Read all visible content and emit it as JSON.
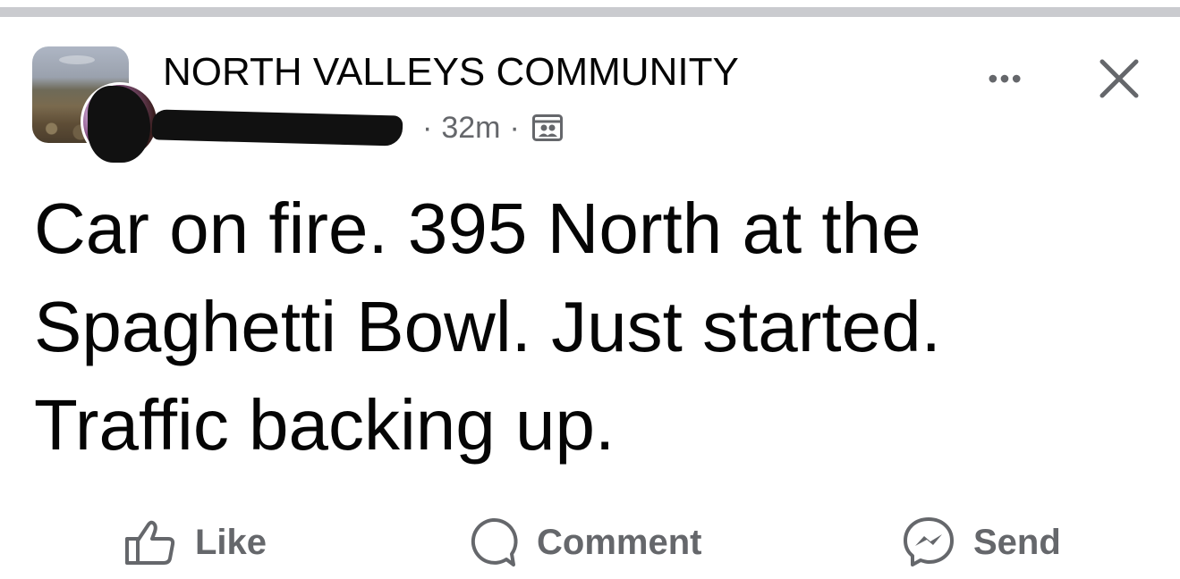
{
  "post": {
    "group_name": "NORTH VALLEYS COMMUNITY",
    "timestamp": "32m",
    "separator": "·",
    "audience_icon": "group-members-icon",
    "more_icon": "more-options-icon",
    "more_label": "•••",
    "close_icon": "close-icon",
    "text": "Car on fire. 395 North at the Spaghetti Bowl.  Just started. Traffic backing up."
  },
  "actions": {
    "like_label": "Like",
    "comment_label": "Comment",
    "send_label": "Send"
  },
  "colors": {
    "text_primary": "#050505",
    "text_secondary": "#65676b",
    "divider": "#cacbcf"
  }
}
